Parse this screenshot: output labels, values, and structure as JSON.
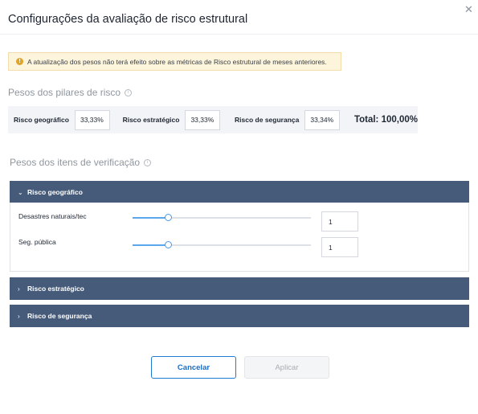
{
  "dialog": {
    "title": "Configurações da avaliação de risco estrutural",
    "close_icon": "close-icon"
  },
  "alert": {
    "icon": "!",
    "icon_name": "warning-icon",
    "text": "A atualização dos pesos não terá efeito sobre as métricas de Risco estrutural de meses anteriores."
  },
  "pillars": {
    "title": "Pesos dos pilares de risco",
    "info_icon": "i",
    "items": [
      {
        "label": "Risco geográfico",
        "value": "33,33%"
      },
      {
        "label": "Risco estratégico",
        "value": "33,33%"
      },
      {
        "label": "Risco de segurança",
        "value": "33,34%"
      }
    ],
    "total": "Total: 100,00%"
  },
  "checks": {
    "title": "Pesos dos itens de verificação",
    "info_icon": "i",
    "sections": [
      {
        "title": "Risco geográfico",
        "expanded": true,
        "chevron": "⌄",
        "items": [
          {
            "label": "Desastres naturais/tec",
            "value": "1",
            "slider_fraction": 0.2
          },
          {
            "label": "Seg. pública",
            "value": "1",
            "slider_fraction": 0.2
          }
        ]
      },
      {
        "title": "Risco estratégico",
        "expanded": false,
        "chevron": "›"
      },
      {
        "title": "Risco de segurança",
        "expanded": false,
        "chevron": "›"
      }
    ]
  },
  "footer": {
    "cancel_label": "Cancelar",
    "apply_label": "Aplicar"
  },
  "colors": {
    "accordion_header": "#465b7a",
    "slider_accent": "#5aa7ee",
    "primary_button": "#1f7ad6",
    "alert_bg": "#fdf4dc"
  }
}
